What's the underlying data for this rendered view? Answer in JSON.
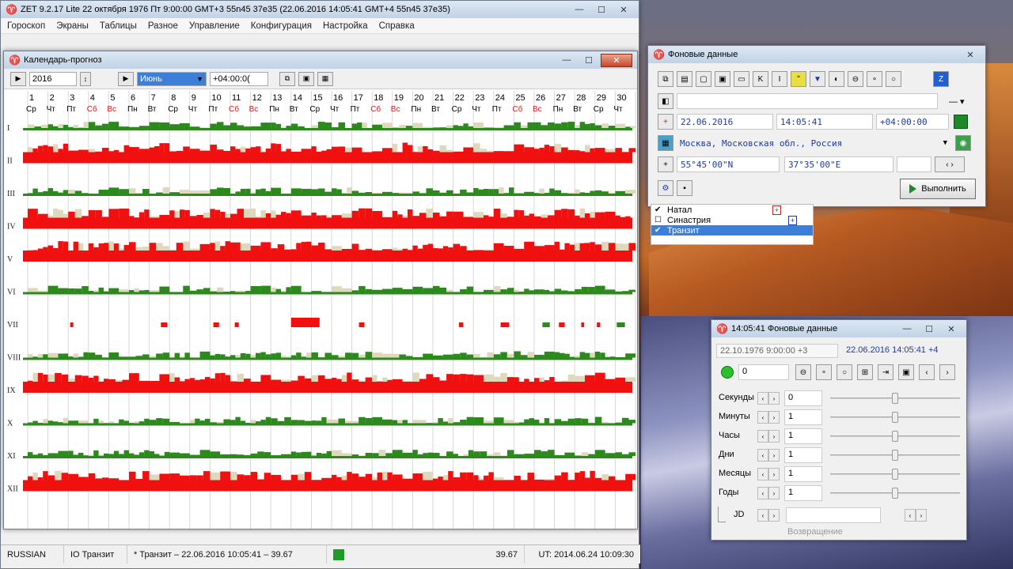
{
  "main_window": {
    "title": "ZET 9.2.17 Lite    22 октября 1976  Пт   9:00:00 GMT+3 55n45  37e35   (22.06.2016  14:05:41 GMT+4 55n45 37e35)",
    "menu": [
      "Гороскоп",
      "Экраны",
      "Таблицы",
      "Разное",
      "Управление",
      "Конфигурация",
      "Настройка",
      "Справка"
    ],
    "status": {
      "language": "RUSSIAN",
      "mode": "IO Транзит",
      "transit": "* Транзит – 22.06.2016 10:05:41 – 39.67",
      "value": "39.67",
      "ut": "UT: 2014.06.24 10:09:30"
    }
  },
  "calendar_window": {
    "title": "Календарь-прогноз",
    "year": "2016",
    "month": "Июнь",
    "tz": "+04:00:0(",
    "days": [
      "1",
      "2",
      "3",
      "4",
      "5",
      "6",
      "7",
      "8",
      "9",
      "10",
      "11",
      "12",
      "13",
      "14",
      "15",
      "16",
      "17",
      "18",
      "19",
      "20",
      "21",
      "22",
      "23",
      "24",
      "25",
      "26",
      "27",
      "28",
      "29",
      "30"
    ],
    "weekdays": [
      "Ср",
      "Чт",
      "Пт",
      "Сб",
      "Вс",
      "Пн",
      "Вт",
      "Ср",
      "Чт",
      "Пт",
      "Сб",
      "Вс",
      "Пн",
      "Вт",
      "Ср",
      "Чт",
      "Пт",
      "Сб",
      "Вс",
      "Пн",
      "Вт",
      "Ср",
      "Чт",
      "Пт",
      "Сб",
      "Вс",
      "Пн",
      "Вт",
      "Ср",
      "Чт"
    ],
    "houses": [
      "I",
      "II",
      "III",
      "IV",
      "V",
      "VI",
      "VII",
      "VIII",
      "IX",
      "X",
      "XI",
      "XII"
    ],
    "colors": {
      "weekend": "#d22020",
      "red": "#f01010",
      "green": "#2c8a1c",
      "beige": "#ded9bd"
    }
  },
  "bgdata_window": {
    "title": "Фоновые данные",
    "date": "22.06.2016",
    "time": "14:05:41",
    "tz": "+04:00:00",
    "place": "Москва, Московская обл., Россия",
    "lat": "55°45'00\"N",
    "lon": "37°35'00\"E",
    "run_label": "Выполнить"
  },
  "list": [
    {
      "label": "Натал",
      "checked": true,
      "selected": false
    },
    {
      "label": "Синастрия",
      "checked": false,
      "selected": false
    },
    {
      "label": "Транзит",
      "checked": true,
      "selected": true
    }
  ],
  "time_window": {
    "title": "14:05:41 Фоновые данные",
    "natal": "22.10.1976  9:00:00  +3",
    "transit": "22.06.2016  14:05:41  +4",
    "counter": "0",
    "rows": [
      {
        "label": "Секунды",
        "value": "0"
      },
      {
        "label": "Минуты",
        "value": "1"
      },
      {
        "label": "Часы",
        "value": "1"
      },
      {
        "label": "Дни",
        "value": "1"
      },
      {
        "label": "Месяцы",
        "value": "1"
      },
      {
        "label": "Годы",
        "value": "1"
      }
    ],
    "jd_label": "JD",
    "extra_label": "Возвращение"
  }
}
